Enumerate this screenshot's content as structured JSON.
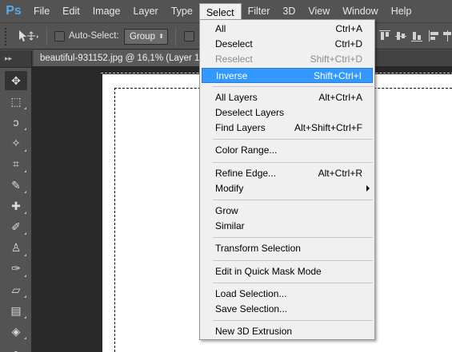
{
  "app": {
    "logo": "Ps"
  },
  "menubar": {
    "items": [
      {
        "label": "File"
      },
      {
        "label": "Edit"
      },
      {
        "label": "Image"
      },
      {
        "label": "Layer"
      },
      {
        "label": "Type"
      },
      {
        "label": "Select"
      },
      {
        "label": "Filter"
      },
      {
        "label": "3D"
      },
      {
        "label": "View"
      },
      {
        "label": "Window"
      },
      {
        "label": "Help"
      }
    ],
    "active": "Select"
  },
  "options": {
    "tool_icon": "move-tool-icon",
    "auto_select_label": "Auto-Select:",
    "auto_select_checked": false,
    "auto_select_value": "Group"
  },
  "document": {
    "tab_title": "beautiful-931152.jpg @ 16,1% (Layer 1"
  },
  "tools": [
    {
      "icon": "move-tool-icon",
      "glyph": "✥",
      "selected": true
    },
    {
      "icon": "rectangular-marquee-icon",
      "glyph": "⬚"
    },
    {
      "icon": "lasso-icon",
      "glyph": "ↄ"
    },
    {
      "icon": "magic-wand-icon",
      "glyph": "✧"
    },
    {
      "icon": "crop-icon",
      "glyph": "⌗"
    },
    {
      "icon": "eyedropper-icon",
      "glyph": "✎"
    },
    {
      "icon": "healing-brush-icon",
      "glyph": "✚"
    },
    {
      "icon": "brush-icon",
      "glyph": "✐"
    },
    {
      "icon": "clone-stamp-icon",
      "glyph": "♙"
    },
    {
      "icon": "history-brush-icon",
      "glyph": "✑"
    },
    {
      "icon": "eraser-icon",
      "glyph": "▱"
    },
    {
      "icon": "gradient-icon",
      "glyph": "▤"
    },
    {
      "icon": "blur-icon",
      "glyph": "◈"
    },
    {
      "icon": "dodge-icon",
      "glyph": "●"
    }
  ],
  "select_menu": {
    "groups": [
      [
        {
          "label": "All",
          "shortcut": "Ctrl+A"
        },
        {
          "label": "Deselect",
          "shortcut": "Ctrl+D"
        },
        {
          "label": "Reselect",
          "shortcut": "Shift+Ctrl+D",
          "disabled": true
        },
        {
          "label": "Inverse",
          "shortcut": "Shift+Ctrl+I",
          "highlighted": true
        }
      ],
      [
        {
          "label": "All Layers",
          "shortcut": "Alt+Ctrl+A"
        },
        {
          "label": "Deselect Layers",
          "shortcut": ""
        },
        {
          "label": "Find Layers",
          "shortcut": "Alt+Shift+Ctrl+F"
        }
      ],
      [
        {
          "label": "Color Range...",
          "shortcut": ""
        }
      ],
      [
        {
          "label": "Refine Edge...",
          "shortcut": "Alt+Ctrl+R"
        },
        {
          "label": "Modify",
          "shortcut": "",
          "submenu": true
        }
      ],
      [
        {
          "label": "Grow",
          "shortcut": ""
        },
        {
          "label": "Similar",
          "shortcut": ""
        }
      ],
      [
        {
          "label": "Transform Selection",
          "shortcut": ""
        }
      ],
      [
        {
          "label": "Edit in Quick Mask Mode",
          "shortcut": ""
        }
      ],
      [
        {
          "label": "Load Selection...",
          "shortcut": ""
        },
        {
          "label": "Save Selection...",
          "shortcut": ""
        }
      ],
      [
        {
          "label": "New 3D Extrusion",
          "shortcut": ""
        }
      ]
    ]
  },
  "colors": {
    "highlight": "#3399ff",
    "menu_bg": "#f0f0f0",
    "chrome": "#535353",
    "canvas_bg": "#282828"
  }
}
